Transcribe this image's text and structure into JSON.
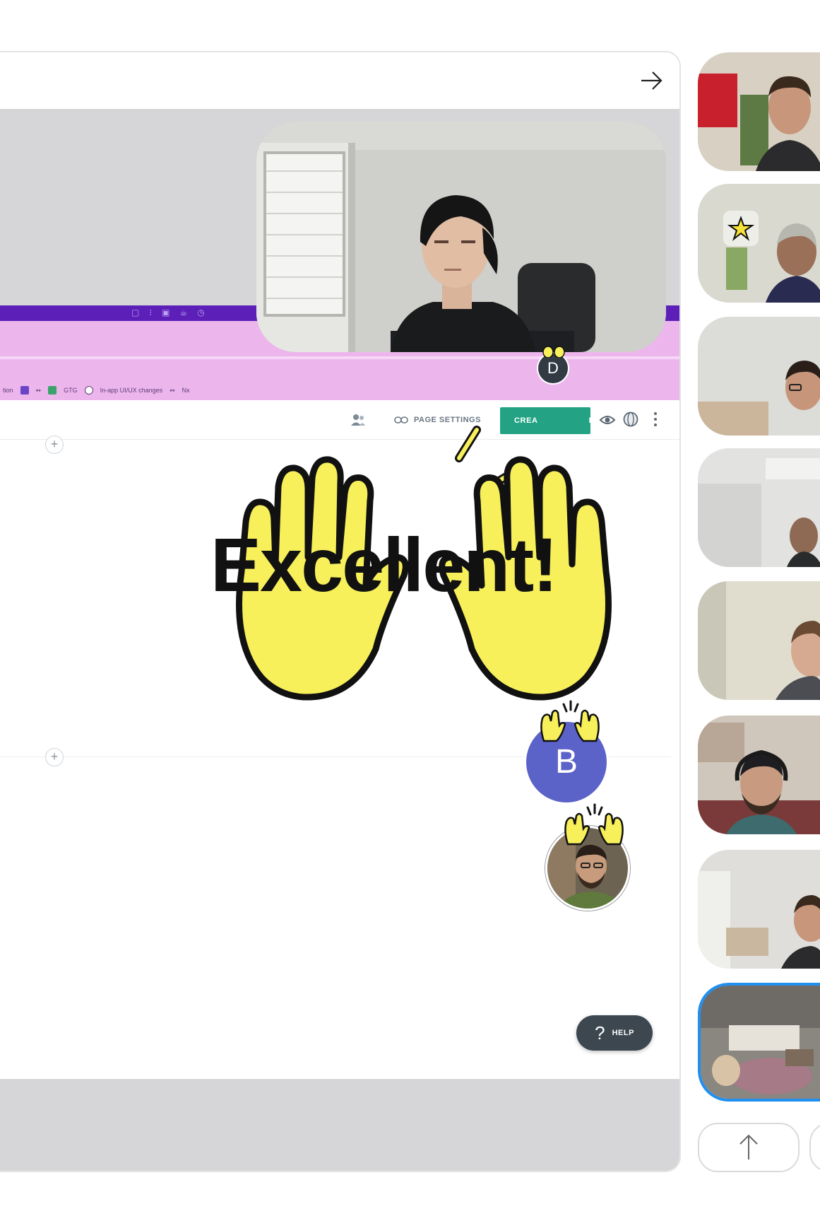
{
  "toolbar": {
    "page_settings_label": "PAGE SETTINGS",
    "create_label": "CREA",
    "create_label_tail": "E"
  },
  "bookmarks": [
    "tion",
    "GTG",
    "In-app UI/UX changes",
    "Nx"
  ],
  "reaction": {
    "text": "Excellent!"
  },
  "participants": {
    "d_initial": "D",
    "b_initial": "B"
  },
  "help": {
    "icon": "?",
    "label": "HELP"
  },
  "icons": {
    "forward": "arrow-right-icon",
    "people": "people-icon",
    "link": "link-icon",
    "preview": "eye-icon",
    "globe": "globe-icon",
    "more": "kebab-icon",
    "scroll_up": "arrow-up-icon"
  },
  "colors": {
    "create_button": "#23a383",
    "avatar_b": "#5b62c8",
    "active_tile_border": "#1f8ff0",
    "reaction_yellow": "#f7f05a",
    "strip_dark": "#5c1fb8",
    "strip_pink": "#ecb6ec",
    "help_button": "#3c4750"
  }
}
